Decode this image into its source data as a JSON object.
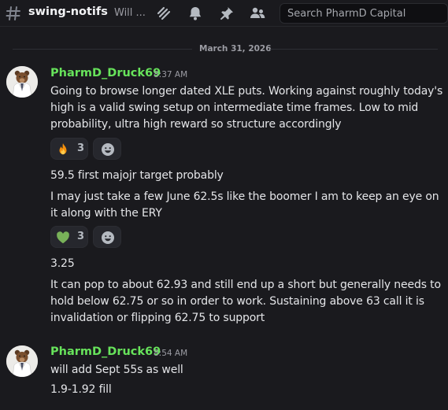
{
  "header": {
    "channel_name": "swing-notifs",
    "topic": "Will ...",
    "search_placeholder": "Search PharmD Capital",
    "icons": [
      "hash-icon",
      "threads-icon",
      "bell-icon",
      "pin-icon",
      "members-icon"
    ]
  },
  "divider": {
    "date": "March 31, 2026"
  },
  "messages": [
    {
      "author": "PharmD_Druck69",
      "time": "8:37 AM",
      "lines": [
        "Going to browse longer dated XLE puts. Working against roughly today's high is a valid swing setup on intermediate time frames. Low to mid probability, ultra high reward so structure accordingly",
        "59.5 first majojr target probably",
        "I may just take a few June 62.5s like the boomer I am to keep an eye on it along with the ERY",
        "3.25",
        "It can pop to about 62.93 and still end up a short but generally needs to hold below 62.75 or so in order to work. Sustaining above 63 call it is invalidation or flipping 62.75 to support"
      ],
      "reactions": [
        {
          "emoji": "fire",
          "count": "3"
        },
        {
          "emoji": "green-heart",
          "count": "3"
        }
      ]
    },
    {
      "author": "PharmD_Druck69",
      "time": "8:54 AM",
      "lines": [
        "will add Sept 55s as well",
        "1.9-1.92 fill"
      ]
    }
  ],
  "colors": {
    "background": "#1a1a1e",
    "author": "#67e35b",
    "text": "#e4e5e8",
    "muted": "#9b9ca3"
  }
}
